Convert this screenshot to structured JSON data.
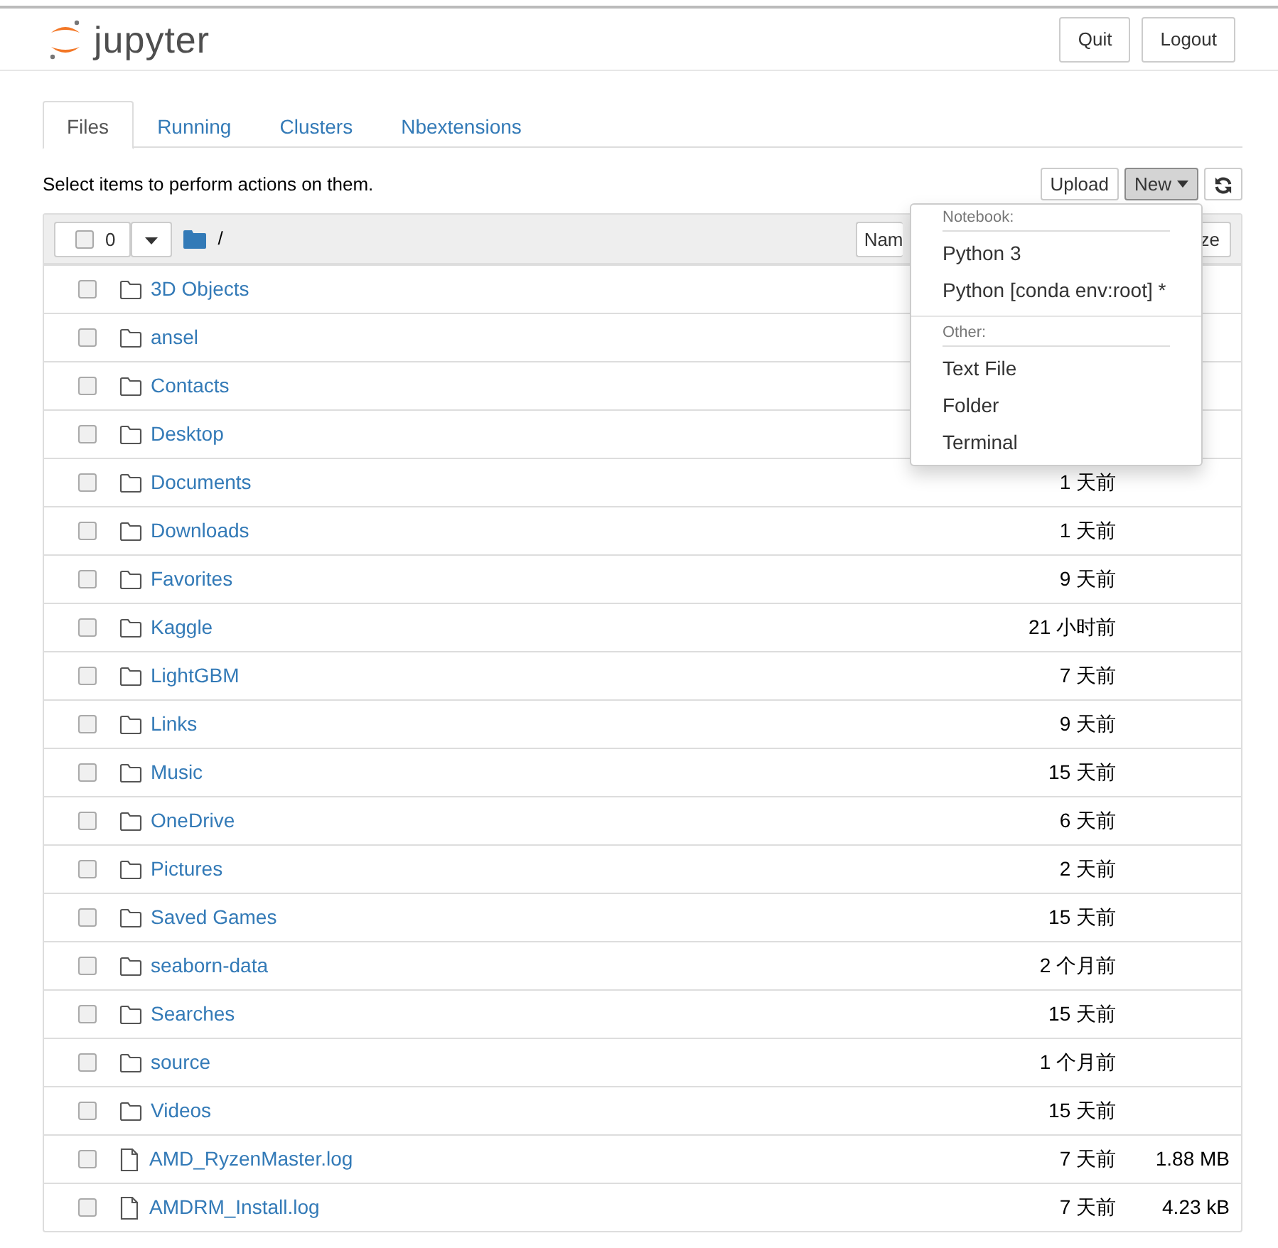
{
  "header": {
    "logo_text": "jupyter",
    "buttons": [
      "Quit",
      "Logout"
    ]
  },
  "tabs": [
    {
      "label": "Files",
      "selected": true
    },
    {
      "label": "Running",
      "selected": false
    },
    {
      "label": "Clusters",
      "selected": false
    },
    {
      "label": "Nbextensions",
      "selected": false
    }
  ],
  "toolbar": {
    "hint": "Select items to perform actions on them.",
    "upload": "Upload",
    "new": "New"
  },
  "list_header": {
    "checked": false,
    "count": "0",
    "path": "/",
    "sort_buttons": [
      "Nam",
      "ze"
    ]
  },
  "new_menu": {
    "sections": [
      {
        "heading": "Notebook:",
        "items": [
          "Python 3",
          "Python [conda env:root] *"
        ]
      },
      {
        "heading": "Other:",
        "items": [
          "Text File",
          "Folder",
          "Terminal"
        ]
      }
    ]
  },
  "rows": [
    {
      "kind": "folder",
      "name": "3D Objects",
      "checked": false
    },
    {
      "kind": "folder",
      "name": "ansel",
      "checked": false
    },
    {
      "kind": "folder",
      "name": "Contacts",
      "checked": false
    },
    {
      "kind": "folder",
      "name": "Desktop",
      "checked": false
    },
    {
      "kind": "folder",
      "name": "Documents",
      "modified": "1 天前",
      "checked": false
    },
    {
      "kind": "folder",
      "name": "Downloads",
      "modified": "1 天前",
      "checked": false
    },
    {
      "kind": "folder",
      "name": "Favorites",
      "modified": "9 天前",
      "checked": false
    },
    {
      "kind": "folder",
      "name": "Kaggle",
      "modified": "21 小时前",
      "checked": false
    },
    {
      "kind": "folder",
      "name": "LightGBM",
      "modified": "7 天前",
      "checked": false
    },
    {
      "kind": "folder",
      "name": "Links",
      "modified": "9 天前",
      "checked": false
    },
    {
      "kind": "folder",
      "name": "Music",
      "modified": "15 天前",
      "checked": false
    },
    {
      "kind": "folder",
      "name": "OneDrive",
      "modified": "6 天前",
      "checked": false
    },
    {
      "kind": "folder",
      "name": "Pictures",
      "modified": "2 天前",
      "checked": false
    },
    {
      "kind": "folder",
      "name": "Saved Games",
      "modified": "15 天前",
      "checked": false
    },
    {
      "kind": "folder",
      "name": "seaborn-data",
      "modified": "2 个月前",
      "checked": false
    },
    {
      "kind": "folder",
      "name": "Searches",
      "modified": "15 天前",
      "checked": false
    },
    {
      "kind": "folder",
      "name": "source",
      "modified": "1 个月前",
      "checked": false
    },
    {
      "kind": "folder",
      "name": "Videos",
      "modified": "15 天前",
      "checked": false
    },
    {
      "kind": "file",
      "name": "AMD_RyzenMaster.log",
      "modified": "7 天前",
      "size": "1.88 MB",
      "checked": false
    },
    {
      "kind": "file",
      "name": "AMDRM_Install.log",
      "modified": "7 天前",
      "size": "4.23 kB",
      "checked": false
    }
  ]
}
